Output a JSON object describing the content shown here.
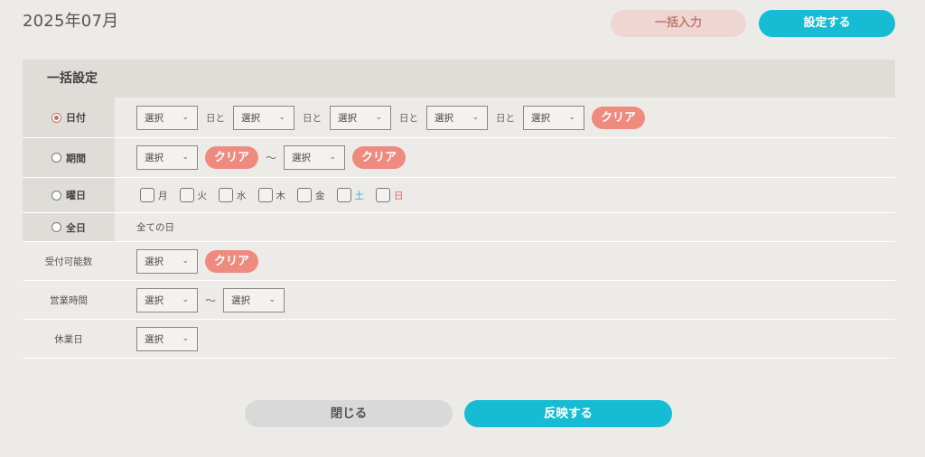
{
  "header": {
    "month": "2025年07月",
    "bulk_input_label": "一括入力",
    "set_label": "設定する"
  },
  "panel": {
    "title": "一括設定",
    "select_placeholder": "選択",
    "clear_label": "クリア",
    "to_separator": "日と",
    "range_separator": "〜",
    "rows": {
      "date": {
        "label": "日付",
        "selected": true
      },
      "period": {
        "label": "期間",
        "selected": false
      },
      "weekday": {
        "label": "曜日",
        "selected": false,
        "days": [
          "月",
          "火",
          "水",
          "木",
          "金",
          "土",
          "日"
        ],
        "colors": {
          "sat": "#2ab0c8",
          "sun": "#d46a5e"
        }
      },
      "all": {
        "label": "全日",
        "selected": false,
        "text": "全ての日"
      },
      "capacity": {
        "label": "受付可能数"
      },
      "hours": {
        "label": "営業時間"
      },
      "holiday": {
        "label": "休業日"
      }
    }
  },
  "footer": {
    "close_label": "閉じる",
    "apply_label": "反映する"
  },
  "colors": {
    "accent": "#16bcd3",
    "clear": "#ee8a7e",
    "bulk_bg": "#f0d6d3"
  }
}
